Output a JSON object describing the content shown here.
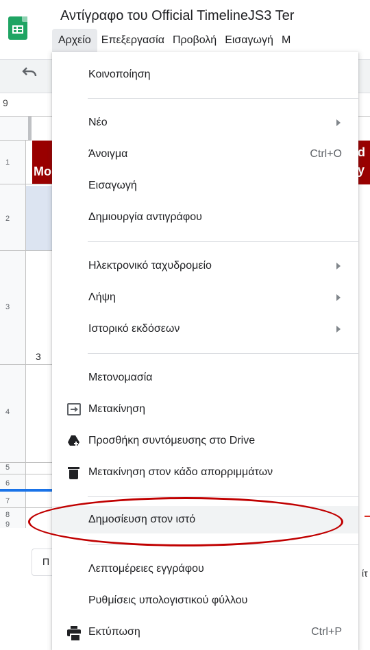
{
  "header": {
    "title": "Αντίγραφο του Official TimelineJS3 Ter",
    "menus": [
      "Αρχείο",
      "Επεξεργασία",
      "Προβολή",
      "Εισαγωγή",
      "Μ"
    ]
  },
  "sheet": {
    "cell_ref": "9",
    "row_numbers": [
      "1",
      "2",
      "3",
      "4",
      "5",
      "6",
      "7",
      "8",
      "9"
    ],
    "header_cell_text": "Mo",
    "right_header_text_1": "d",
    "right_header_text_2": "y",
    "cell_value": "3",
    "tab_label": "Π",
    "right_fragment": "ίτ"
  },
  "menu": {
    "share": "Κοινοποίηση",
    "new": "Νέο",
    "open": "Άνοιγμα",
    "open_shortcut": "Ctrl+O",
    "import": "Εισαγωγή",
    "make_copy": "Δημιουργία αντιγράφου",
    "email": "Ηλεκτρονικό ταχυδρομείο",
    "download": "Λήψη",
    "version_history": "Ιστορικό εκδόσεων",
    "rename": "Μετονομασία",
    "move": "Μετακίνηση",
    "add_shortcut": "Προσθήκη συντόμευσης στο Drive",
    "trash": "Μετακίνηση στον κάδο απορριμμάτων",
    "publish": "Δημοσίευση στον ιστό",
    "details": "Λεπτομέρειες εγγράφου",
    "settings": "Ρυθμίσεις υπολογιστικού φύλλου",
    "print": "Εκτύπωση",
    "print_shortcut": "Ctrl+P"
  },
  "icons": {
    "app": "google-sheets-icon",
    "undo": "undo-icon",
    "move": "move-folder-icon",
    "drive_shortcut": "drive-shortcut-icon",
    "trash": "trash-icon",
    "print": "print-icon"
  },
  "colors": {
    "sheets_green": "#1fa463",
    "header_red": "#990000",
    "annotation_red": "#c00000",
    "highlight": "#f1f3f4",
    "selection_blue": "#1a73e8"
  }
}
